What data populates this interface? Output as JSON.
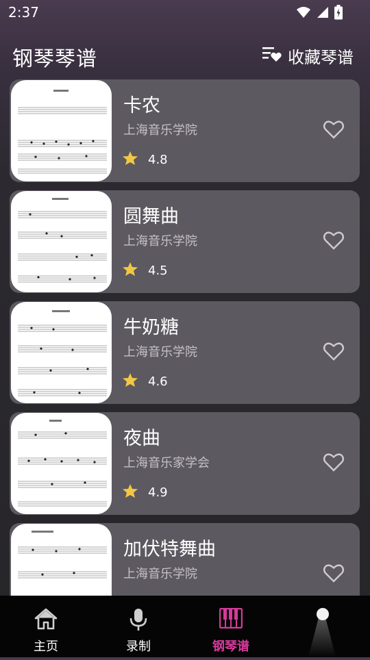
{
  "status": {
    "time": "2:37"
  },
  "header": {
    "title": "钢琴琴谱",
    "favorites_label": "收藏琴谱"
  },
  "scores": [
    {
      "title": "卡农",
      "publisher": "上海音乐学院",
      "rating": "4.8"
    },
    {
      "title": "圆舞曲",
      "publisher": "上海音乐学院",
      "rating": "4.5"
    },
    {
      "title": "牛奶糖",
      "publisher": "上海音乐学院",
      "rating": "4.6"
    },
    {
      "title": "夜曲",
      "publisher": "上海音乐家学会",
      "rating": "4.9"
    },
    {
      "title": "加伏特舞曲",
      "publisher": "上海音乐学院",
      "rating": ""
    }
  ],
  "nav": {
    "home": "主页",
    "record": "录制",
    "piano_scores": "钢琴谱"
  },
  "colors": {
    "accent": "#d63a9a",
    "star": "#f2c744",
    "card": "#5d5961"
  },
  "icons": [
    "wifi-icon",
    "signal-icon",
    "battery-icon",
    "playlist-heart-icon",
    "heart-outline-icon",
    "star-icon",
    "home-icon",
    "microphone-icon",
    "piano-icon"
  ]
}
